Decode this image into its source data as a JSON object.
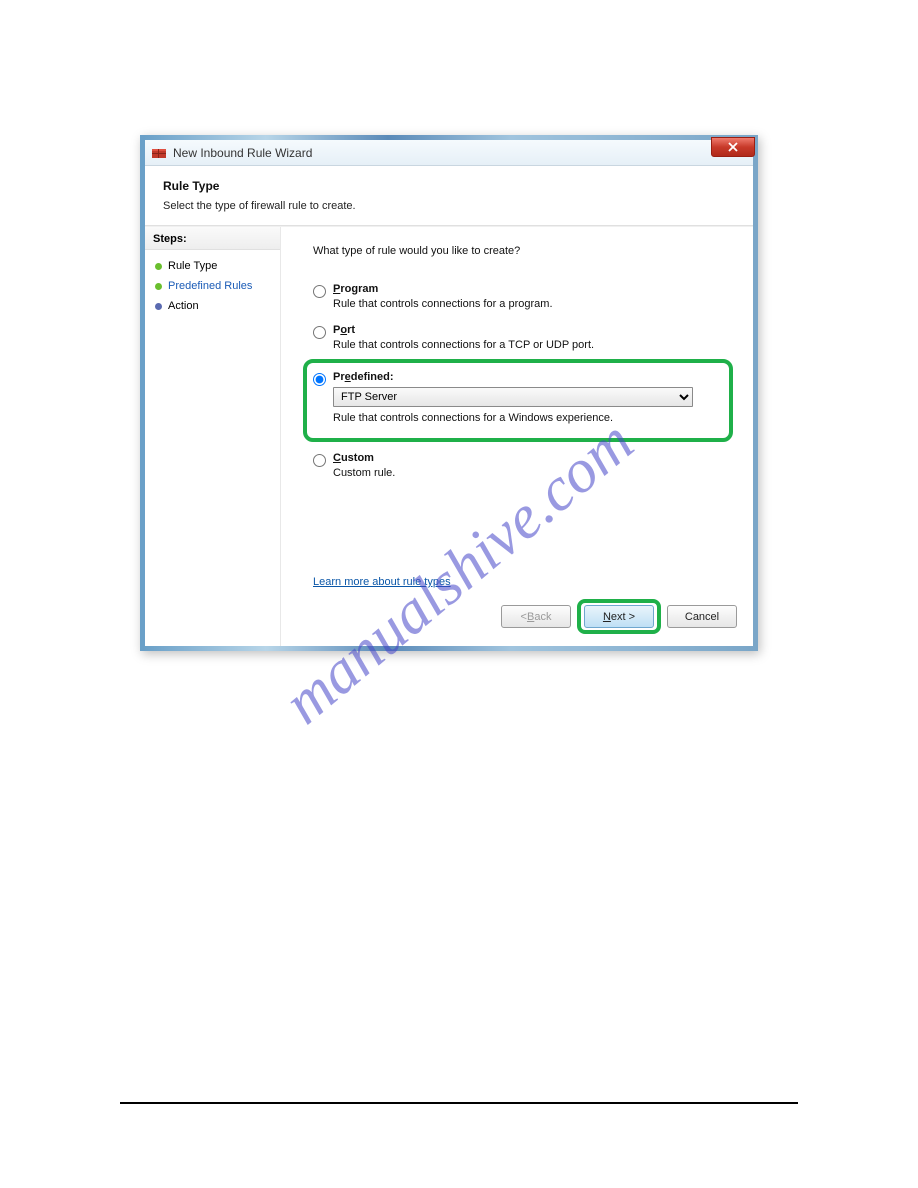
{
  "watermark": "manualshive.com",
  "window": {
    "title": "New Inbound Rule Wizard"
  },
  "header": {
    "title": "Rule Type",
    "subtitle": "Select the type of firewall rule to create."
  },
  "sidebar": {
    "steps_label": "Steps:",
    "items": [
      {
        "label": "Rule Type",
        "kind": "active"
      },
      {
        "label": "Predefined Rules",
        "kind": "link"
      },
      {
        "label": "Action",
        "kind": "action"
      }
    ]
  },
  "content": {
    "question": "What type of rule would you like to create?",
    "options": {
      "program": {
        "label": "Program",
        "accel": "P",
        "desc": "Rule that controls connections for a program."
      },
      "port": {
        "label": "Port",
        "accel": "o",
        "desc": "Rule that controls connections for a TCP or UDP port."
      },
      "predef": {
        "label": "Predefined:",
        "accel": "e",
        "desc": "Rule that controls connections for a Windows experience.",
        "selected_value": "FTP Server"
      },
      "custom": {
        "label": "Custom",
        "accel": "C",
        "desc": "Custom rule."
      }
    },
    "learn_more": "Learn more about rule types"
  },
  "buttons": {
    "back": "< Back",
    "next": "Next >",
    "cancel": "Cancel"
  }
}
